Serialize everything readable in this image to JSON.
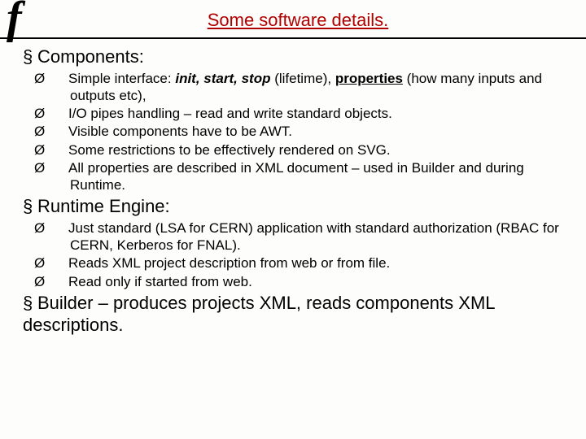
{
  "logo": "f",
  "title": "Some software details.",
  "sec1": {
    "heading": "Components:",
    "i1_pre": "Simple interface: ",
    "i1_bi": "init,  start,  stop ",
    "i1_mid": "(lifetime), ",
    "i1_bu": "properties",
    "i1_post": " (how many inputs and outputs etc),",
    "i2": "I/O pipes handling – read and write standard objects.",
    "i3": "Visible components have to be AWT.",
    "i4": "Some restrictions to be effectively rendered on SVG.",
    "i5": "All properties are described in XML document – used in Builder and during Runtime."
  },
  "sec2": {
    "heading": "Runtime Engine:",
    "i1": "Just standard (LSA for CERN) application with standard authorization (RBAC for CERN, Kerberos for FNAL).",
    "i2": "Reads XML project description from web or from file.",
    "i3": "Read only if started from web."
  },
  "sec3": {
    "heading": "Builder – produces projects XML, reads components XML descriptions."
  },
  "bullets": {
    "square": "§",
    "arrow": "Ø"
  }
}
